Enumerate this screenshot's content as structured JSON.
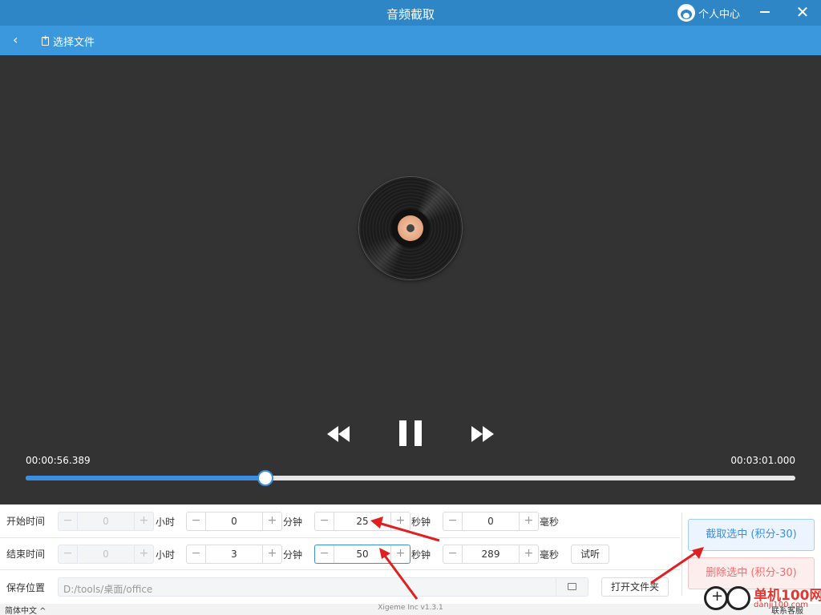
{
  "window": {
    "title": "音频截取",
    "user_center": "个人中心"
  },
  "toolbar": {
    "back": "‹",
    "select_file": "选择文件"
  },
  "player": {
    "current_time": "00:00:56.389",
    "total_time": "00:03:01.000",
    "progress_fraction": 0.311,
    "state": "playing"
  },
  "start_time": {
    "label": "开始时间",
    "hours": "0",
    "hours_unit": "小时",
    "minutes": "0",
    "minutes_unit": "分钟",
    "seconds": "25",
    "seconds_unit": "秒钟",
    "ms": "0",
    "ms_unit": "毫秒"
  },
  "end_time": {
    "label": "结束时间",
    "hours": "0",
    "hours_unit": "小时",
    "minutes": "3",
    "minutes_unit": "分钟",
    "seconds": "50",
    "seconds_unit": "秒钟",
    "ms": "289",
    "ms_unit": "毫秒",
    "preview_label": "试听"
  },
  "save": {
    "label": "保存位置",
    "path": "D:/tools/桌面/office",
    "open_folder_label": "打开文件夹"
  },
  "actions": {
    "cut_label": "截取选中 (积分-30)",
    "delete_label": "删除选中 (积分-30)"
  },
  "stepper_symbols": {
    "minus": "−",
    "plus": "+"
  },
  "status_bar": {
    "language": "简体中文 ^",
    "version": "Xigeme Inc v1.3.1",
    "contact": "联系客服"
  },
  "watermark": {
    "brand": "单机100网",
    "url": "danji100.com"
  },
  "colors": {
    "titlebar": "#2e86c7",
    "toolbar": "#3b98dd",
    "player_bg": "#333333",
    "accent": "#3b8fe0",
    "danger": "#f56c6c",
    "annotation_arrow": "#e02020"
  }
}
